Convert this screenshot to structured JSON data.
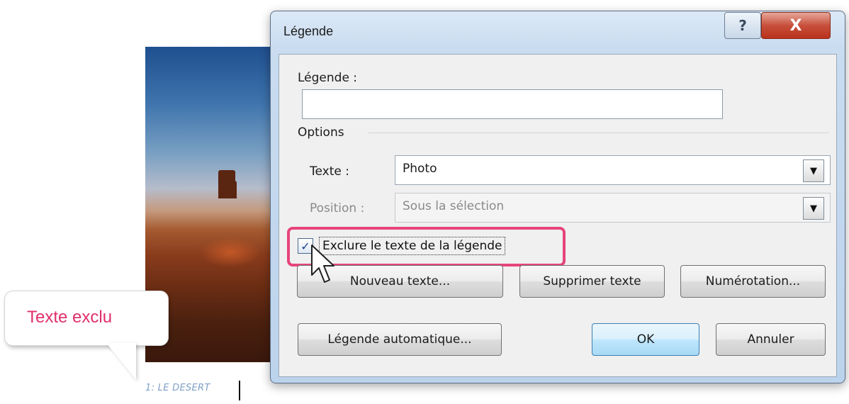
{
  "document": {
    "caption": "1: LE DESERT",
    "callout": "Texte exclu"
  },
  "dialog": {
    "title": "Légende",
    "help_glyph": "?",
    "close_glyph": "X",
    "caption_label": "Légende :",
    "caption_value": "",
    "options_label": "Options",
    "text_label": "Texte :",
    "text_value": "Photo",
    "position_label": "Position :",
    "position_value": "Sous la sélection",
    "exclude_label": "Exclure le texte de la légende",
    "exclude_checked": true,
    "new_text_button": "Nouveau texte...",
    "delete_text_button": "Supprimer texte",
    "numbering_button": "Numérotation...",
    "auto_caption_button": "Légende automatique...",
    "ok_button": "OK",
    "cancel_button": "Annuler"
  },
  "colors": {
    "highlight": "#e6457a",
    "callout_text": "#e0306c",
    "caption_text": "#7fa0c8"
  }
}
